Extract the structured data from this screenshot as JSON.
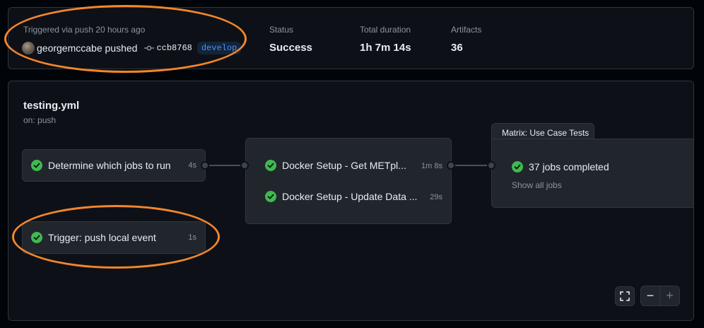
{
  "run": {
    "trigger_text": "Triggered via push 20 hours ago",
    "user": "georgemccabe pushed",
    "commit": "ccb8768",
    "branch": "develop"
  },
  "stats": [
    {
      "label": "Status",
      "value": "Success"
    },
    {
      "label": "Total duration",
      "value": "1h 7m 14s"
    },
    {
      "label": "Artifacts",
      "value": "36"
    }
  ],
  "workflow": {
    "file": "testing.yml",
    "trigger": "on: push"
  },
  "jobs": {
    "determine": {
      "name": "Determine which jobs to run",
      "duration": "4s",
      "status": "success"
    },
    "trigger": {
      "name": "Trigger: push local event",
      "duration": "1s",
      "status": "success"
    },
    "docker_get": {
      "name": "Docker Setup - Get METpl...",
      "duration": "1m 8s",
      "status": "success"
    },
    "docker_update": {
      "name": "Docker Setup - Update Data ...",
      "duration": "29s",
      "status": "success"
    }
  },
  "matrix": {
    "title": "Matrix: Use Case Tests",
    "summary": "37 jobs completed",
    "show_all": "Show all jobs"
  },
  "controls": {
    "zoom_out": "−",
    "zoom_in": "+"
  },
  "icons": [
    "avatar",
    "commit-icon",
    "check-circle-icon",
    "fullscreen-icon"
  ],
  "colors": {
    "success": "#3fb950",
    "branch": "#4493f8",
    "annotation": "#f5862b"
  }
}
